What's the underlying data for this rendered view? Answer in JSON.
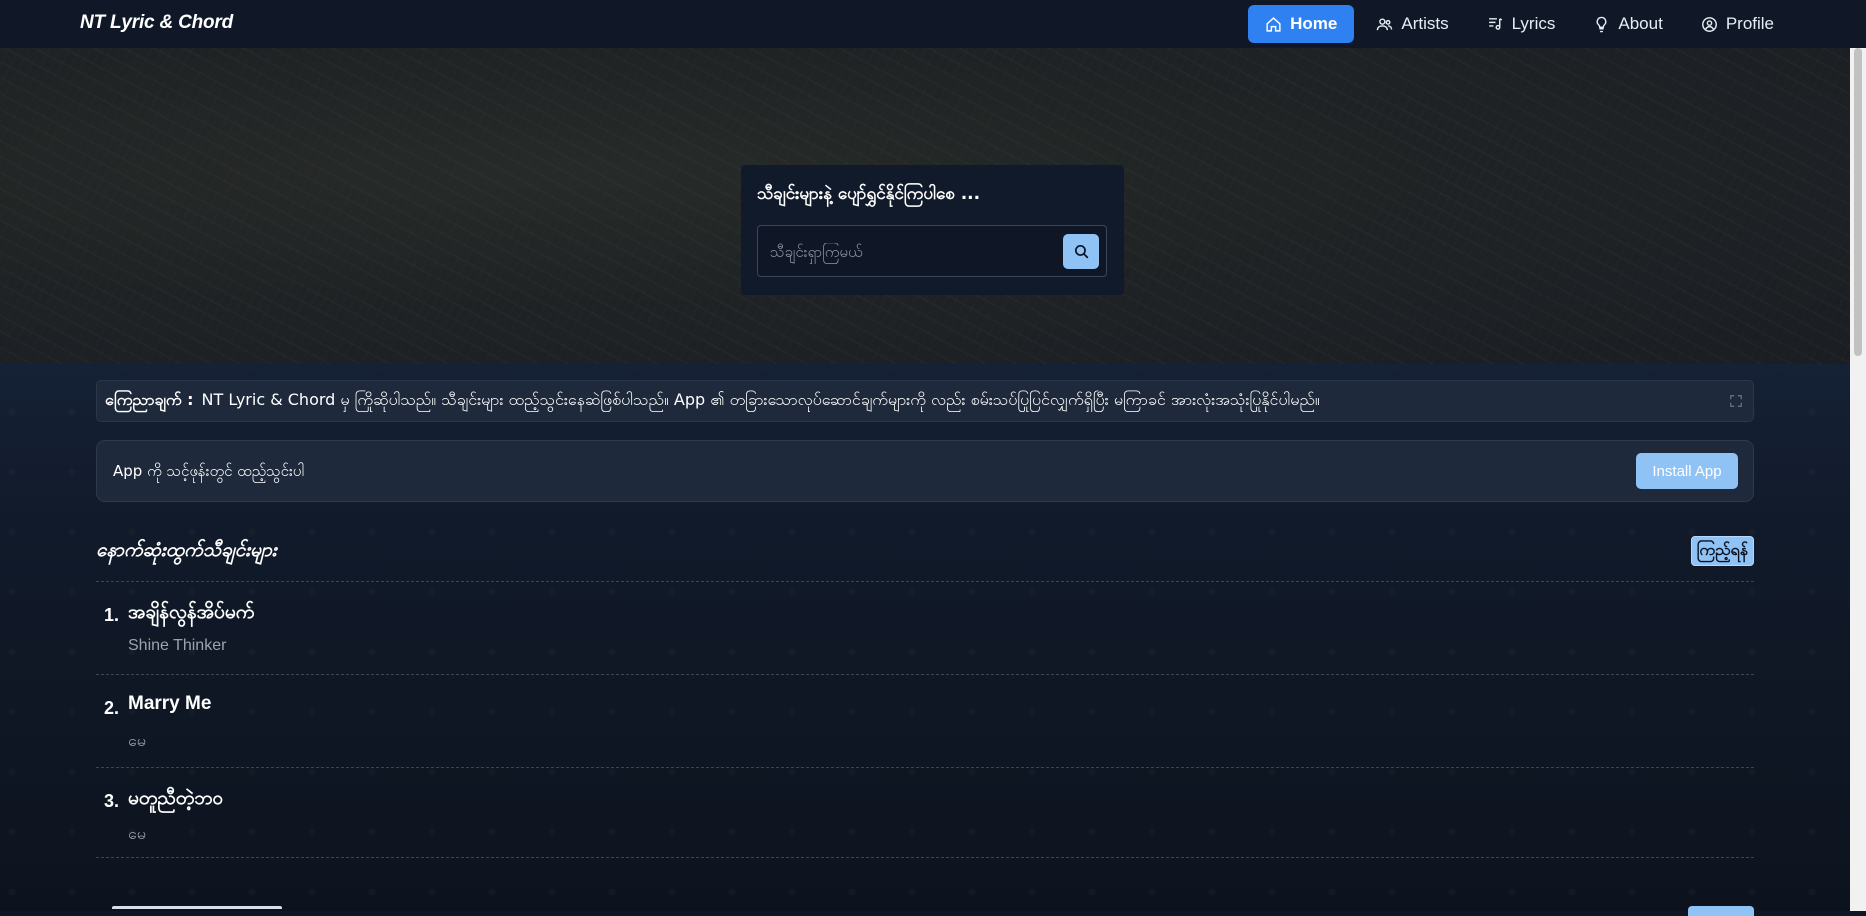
{
  "nav": {
    "brand": "NT Lyric & Chord",
    "items": [
      {
        "label": "Home",
        "icon": "home-icon",
        "active": true
      },
      {
        "label": "Artists",
        "icon": "users-icon",
        "active": false
      },
      {
        "label": "Lyrics",
        "icon": "music-note-icon",
        "active": false
      },
      {
        "label": "About",
        "icon": "lightbulb-icon",
        "active": false
      },
      {
        "label": "Profile",
        "icon": "user-circle-icon",
        "active": false
      }
    ]
  },
  "search": {
    "title": "သီချင်းများနဲ့ ပျော်ရွှင်နိုင်ကြပါစေ ...",
    "placeholder": "သီချင်းရှာကြမယ်",
    "value": ""
  },
  "notice": {
    "label": "ကြေညာချက် :",
    "text": "NT Lyric & Chord မှ ကြိုဆိုပါသည်။ သီချင်းများ ထည့်သွင်းနေဆဲဖြစ်ပါသည်။ App ၏ တခြားသောလုပ်ဆောင်ချက်များကို လည်း စမ်းသပ်ပြုပြင်လျှက်ရှိပြီး မကြာခင် အားလုံးအသုံးပြုနိုင်ပါမည်။"
  },
  "install": {
    "text": "App ကို သင့်ဖုန်းတွင် ထည့်သွင်းပါ",
    "button": "Install App"
  },
  "latest": {
    "title": "နောက်ဆုံးထွက်သီချင်းများ",
    "view_button": "ကြည့်ရန်",
    "songs": [
      {
        "num": "1.",
        "title": "အချိန်လွန်အိပ်မက်",
        "artist": "Shine Thinker"
      },
      {
        "num": "2.",
        "title": "Marry Me",
        "artist": "မေ"
      },
      {
        "num": "3.",
        "title": "မတူညီတဲ့ဘဝ",
        "artist": "မေ"
      }
    ]
  },
  "colors": {
    "accent": "#2f80f0",
    "button_light": "#8fc2f5",
    "nav_bg": "#101827",
    "card_bg": "#1e293b"
  }
}
